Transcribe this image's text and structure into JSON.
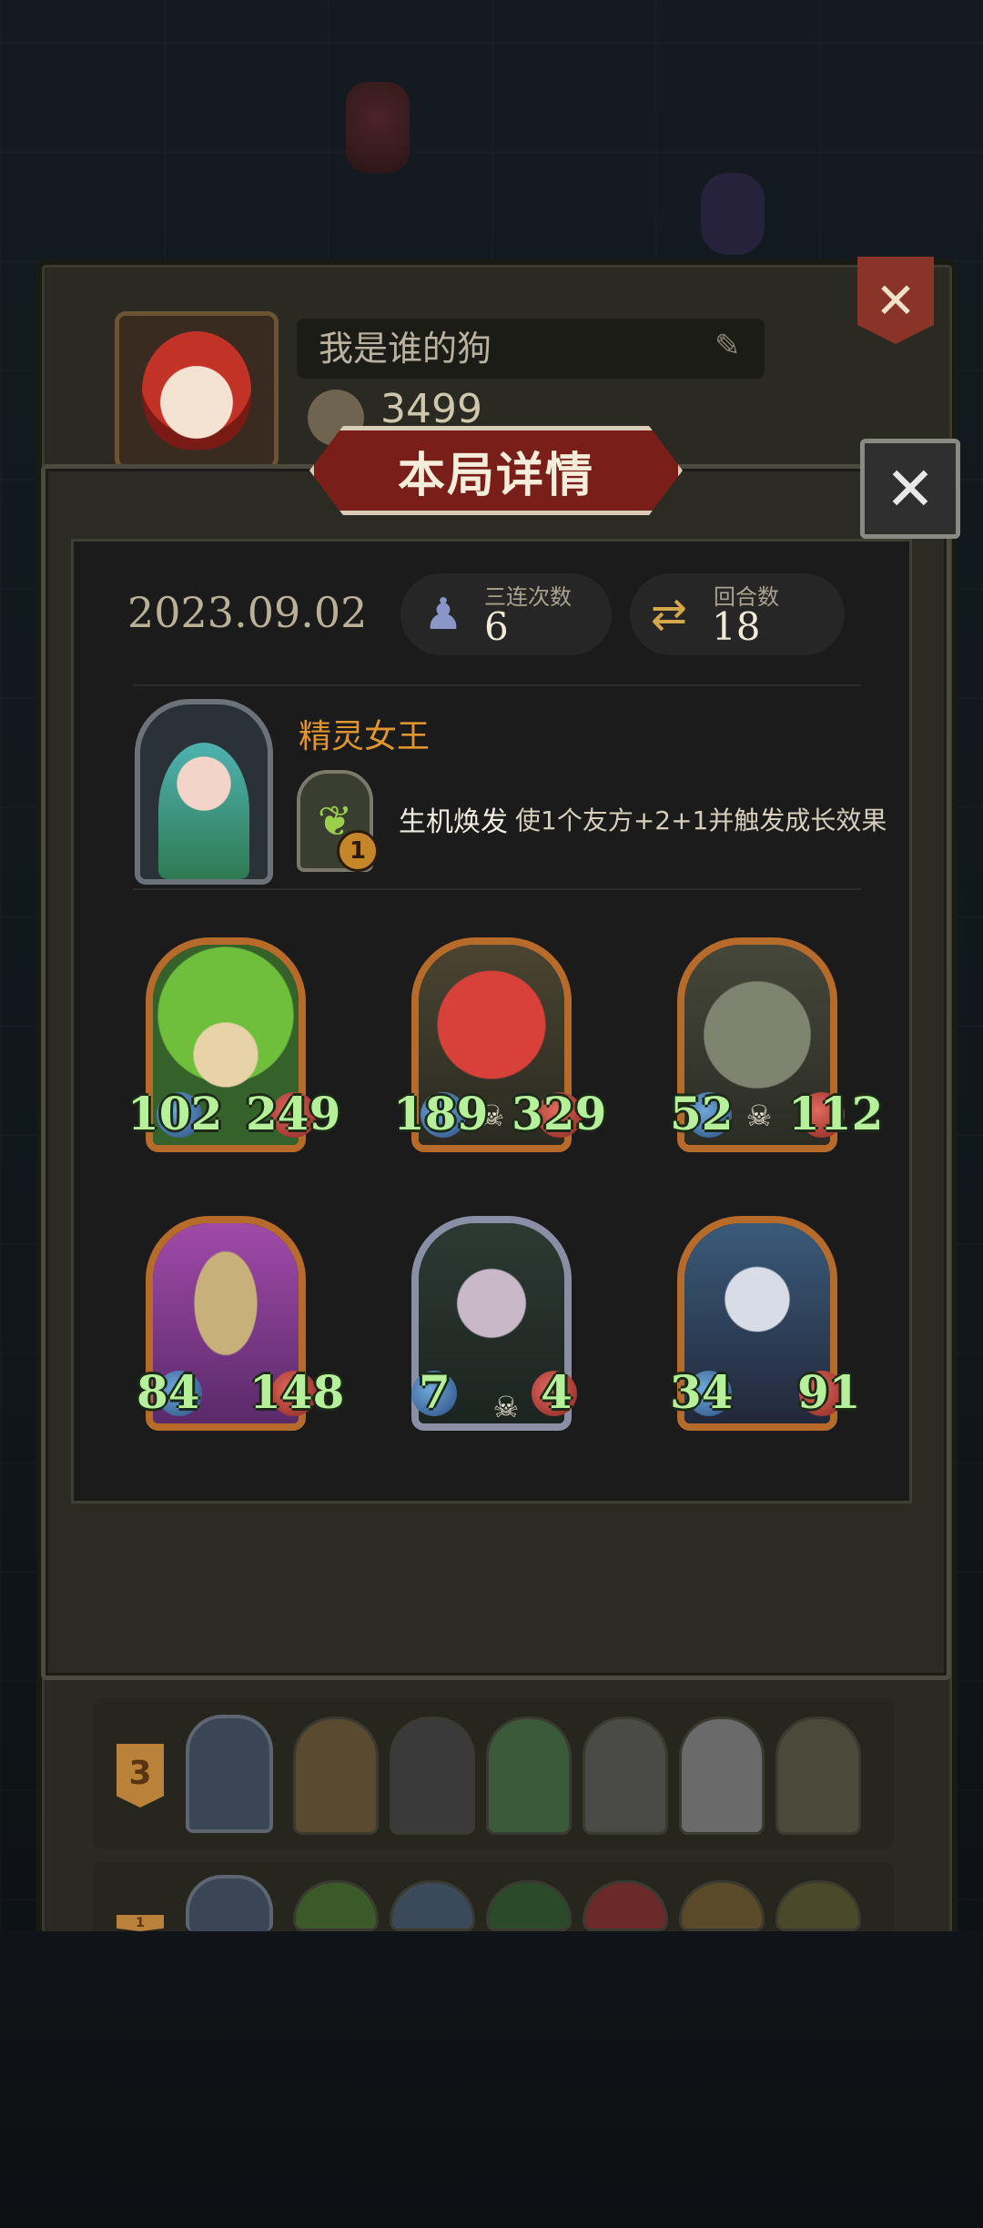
{
  "profile": {
    "player_name": "我是谁的狗",
    "score": "3499"
  },
  "modal": {
    "title": "本局详情",
    "date": "2023.09.02",
    "stats": [
      {
        "label": "三连次数",
        "value": "6",
        "icon": "triple-icon"
      },
      {
        "label": "回合数",
        "value": "18",
        "icon": "rounds-icon"
      }
    ],
    "hero": {
      "name": "精灵女王",
      "skill_level": "1",
      "skill_name": "生机焕发",
      "skill_desc": "使1个友方+2+1并触发成长效果"
    },
    "units": [
      {
        "attack": "102",
        "health": "249",
        "frame": "gold",
        "art": "leaf-child"
      },
      {
        "attack": "189",
        "health": "329",
        "frame": "gold",
        "art": "red-imp"
      },
      {
        "attack": "52",
        "health": "112",
        "frame": "gold",
        "art": "stone-golem"
      },
      {
        "attack": "84",
        "health": "148",
        "frame": "gold",
        "art": "mushroom-spider"
      },
      {
        "attack": "7",
        "health": "4",
        "frame": "silver",
        "art": "demon-girl"
      },
      {
        "attack": "34",
        "health": "91",
        "frame": "gold",
        "art": "elf-sorceress"
      }
    ]
  },
  "history": [
    {
      "rank": "3"
    },
    {
      "rank": "1"
    }
  ],
  "colors": {
    "accent_gold": "#e0952e",
    "stat_green": "#b6f09a",
    "banner_red": "#7a1e1a"
  }
}
